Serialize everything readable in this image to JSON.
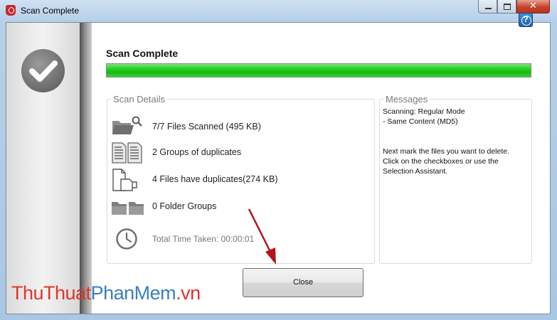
{
  "window": {
    "title": "Scan Complete",
    "close_symbol": "✕"
  },
  "header": {
    "title": "Scan Complete",
    "progress_percent": 100
  },
  "scan_details": {
    "legend": "Scan Details",
    "rows": [
      {
        "icon": "folder-search-icon",
        "text": "7/7 Files Scanned (495 KB)"
      },
      {
        "icon": "duplicate-documents-icon",
        "text": "2 Groups of duplicates"
      },
      {
        "icon": "duplicate-files-icon",
        "text": "4 Files have duplicates(274 KB)"
      },
      {
        "icon": "folder-groups-icon",
        "text": "0 Folder Groups"
      },
      {
        "icon": "clock-icon",
        "text": "Total Time Taken: 00:00:01"
      }
    ]
  },
  "messages": {
    "legend": "Messages",
    "lines": [
      "Scanning: Regular Mode",
      "- Same Content (MD5)",
      "Next mark the files you want to delete.",
      "Click on the checkboxes or use the",
      "Selection Assistant."
    ]
  },
  "buttons": {
    "close_label": "Close"
  },
  "watermark": {
    "part1": "ThuThuat",
    "part2": "PhanMem",
    "part3": ".vn"
  },
  "colors": {
    "progress_green": "#1fc61b",
    "help_blue": "#1e5fa8",
    "arrow_red": "#b3151b"
  }
}
